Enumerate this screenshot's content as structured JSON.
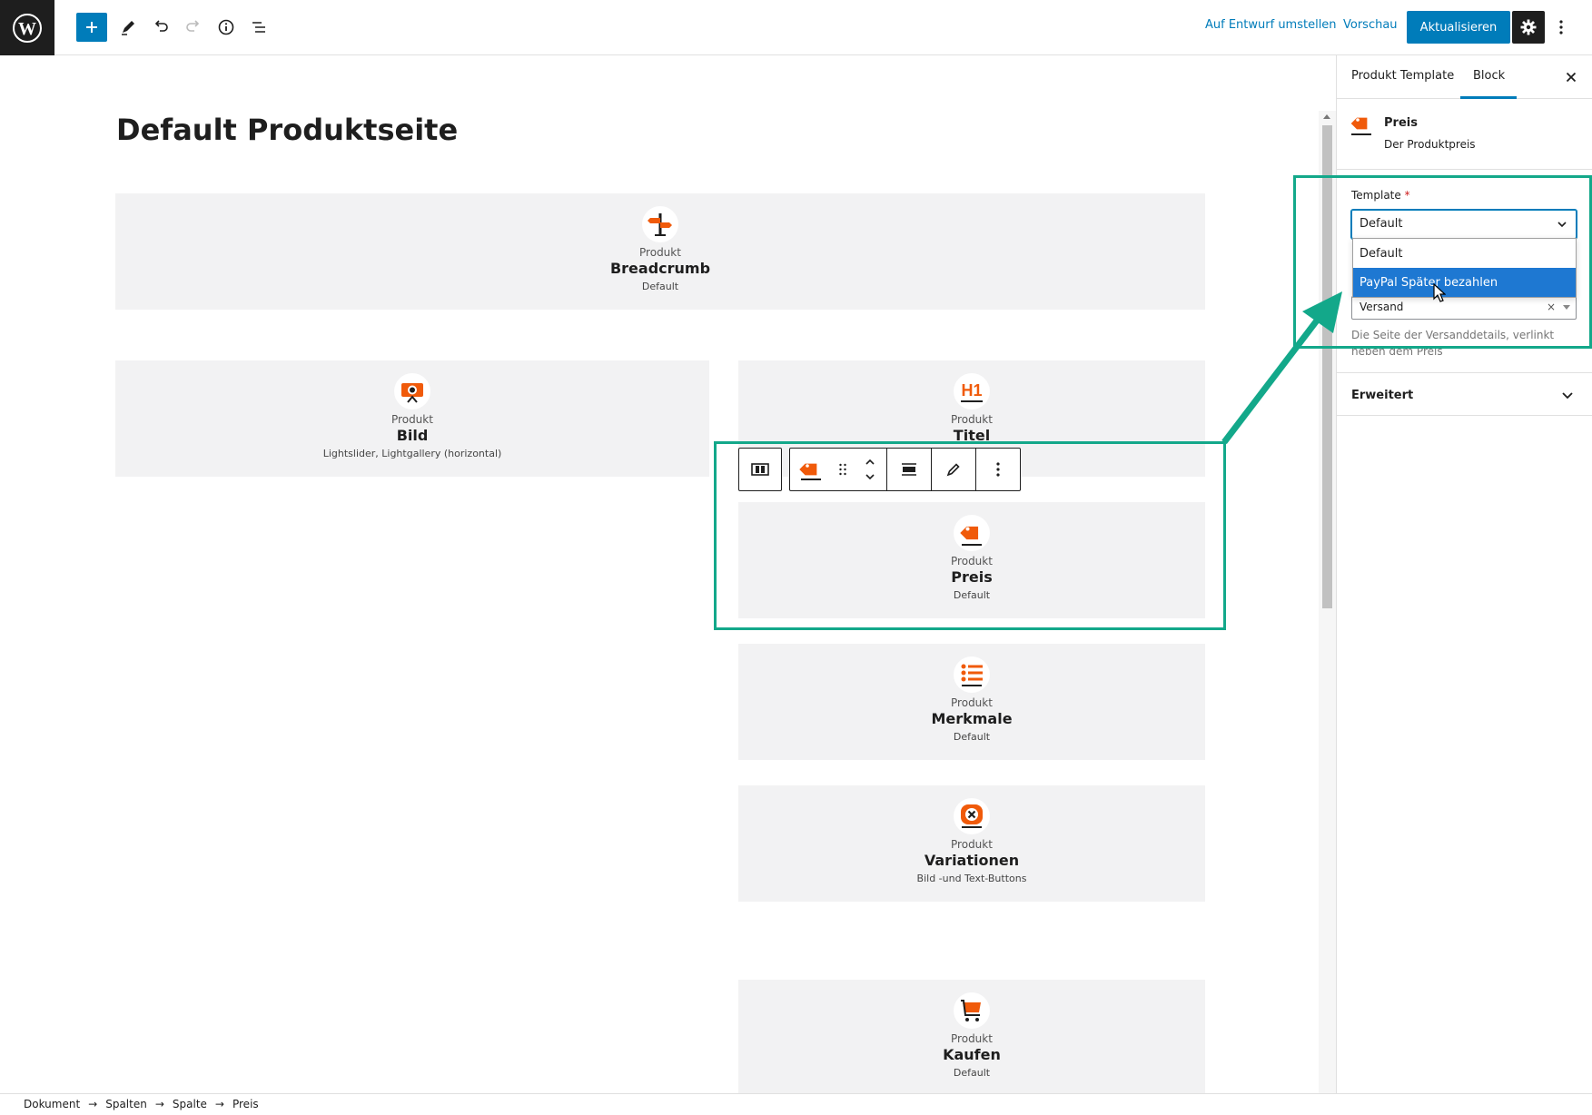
{
  "topbar": {
    "draft_label": "Auf Entwurf umstellen",
    "preview_label": "Vorschau",
    "update_label": "Aktualisieren"
  },
  "editor": {
    "page_title": "Default Produktseite",
    "blocks": [
      {
        "label": "Produkt",
        "title": "Breadcrumb",
        "subtitle": "Default",
        "icon": "signpost-icon"
      },
      {
        "label": "Produkt",
        "title": "Bild",
        "subtitle": "Lightslider, Lightgallery (horizontal)",
        "icon": "camera-icon"
      },
      {
        "label": "Produkt",
        "title": "Titel",
        "subtitle": "",
        "icon": "h1-icon"
      },
      {
        "label": "Produkt",
        "title": "Preis",
        "subtitle": "Default",
        "icon": "price-tag-icon"
      },
      {
        "label": "Produkt",
        "title": "Merkmale",
        "subtitle": "Default",
        "icon": "list-icon"
      },
      {
        "label": "Produkt",
        "title": "Variationen",
        "subtitle": "Bild -und Text-Buttons",
        "icon": "variations-icon"
      },
      {
        "label": "Produkt",
        "title": "Kaufen",
        "subtitle": "Default",
        "icon": "cart-icon"
      }
    ]
  },
  "sidebar": {
    "tabs": [
      {
        "label": "Produkt Template",
        "active": false
      },
      {
        "label": "Block",
        "active": true
      }
    ],
    "block_card": {
      "name": "Preis",
      "description": "Der Produktpreis"
    },
    "template_field": {
      "label": "Template",
      "required_mark": "*",
      "value": "Default",
      "options": [
        "Default",
        "PayPal Später bezahlen"
      ],
      "highlighted_option": "PayPal Später bezahlen"
    },
    "versand_field": {
      "value": "Versand",
      "clear": "×"
    },
    "help_text": "Die Seite der Versanddetails, verlinkt neben dem Preis",
    "advanced_label": "Erweitert"
  },
  "footer": {
    "breadcrumbs": [
      "Dokument",
      "Spalten",
      "Spalte",
      "Preis"
    ],
    "separator": "→"
  },
  "colors": {
    "accent": "#007cba",
    "annotation": "#13a88a",
    "icon_orange": "#f05a0a",
    "block_bg": "#f2f2f3"
  }
}
